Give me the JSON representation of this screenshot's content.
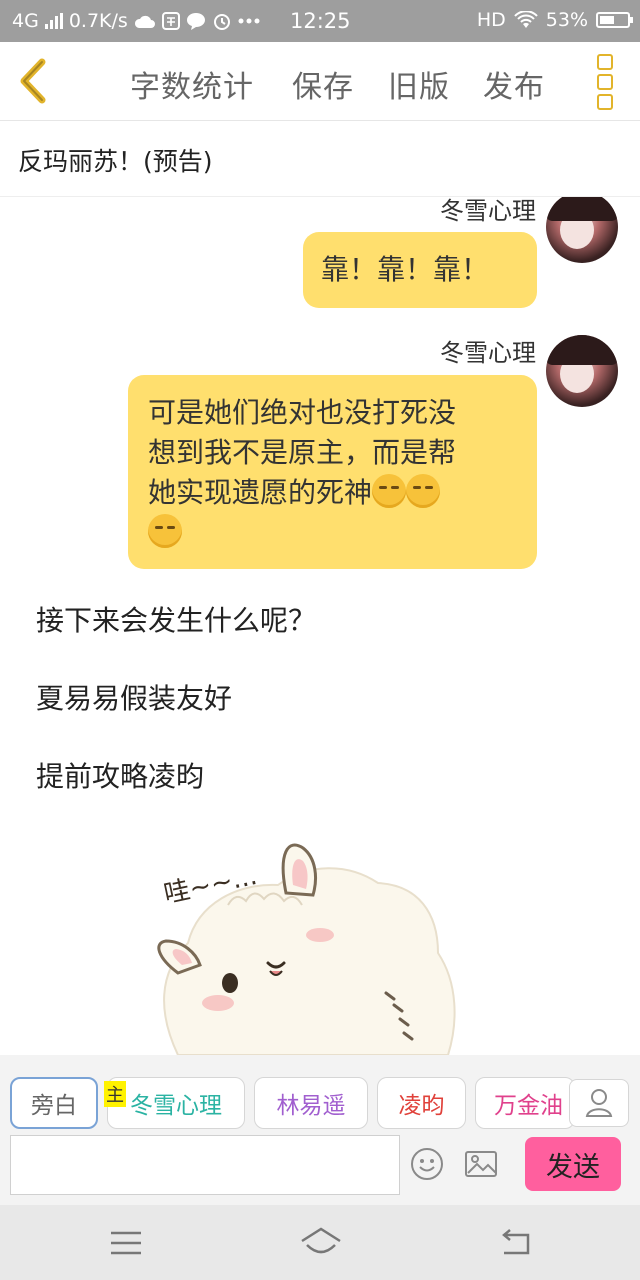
{
  "status_bar": {
    "network": "4G",
    "speed": "0.7K/s",
    "time": "12:25",
    "hd": "HD",
    "battery_text": "53%",
    "battery_level": 0.53
  },
  "toolbar": {
    "word_count": "字数统计",
    "save": "保存",
    "old_version": "旧版",
    "publish": "发布"
  },
  "story": {
    "title": "反玛丽苏！(预告)"
  },
  "chat": {
    "messages": [
      {
        "sender": "冬雪心理",
        "text": "靠！靠！靠！"
      },
      {
        "sender": "冬雪心理",
        "line1": "可是她们绝对也没打死没",
        "line2": "想到我不是原主，而是帮",
        "line3": "她实现遗愿的死神"
      }
    ],
    "narrations": [
      "接下来会发生什么呢？",
      "夏易易假装友好",
      "提前攻略凌昀"
    ],
    "sticker_caption": "哇~~..."
  },
  "roles": {
    "items": [
      {
        "label": "旁白",
        "color": "#666666"
      },
      {
        "label": "冬雪心理",
        "color": "#2bb3a3"
      },
      {
        "label": "林易遥",
        "color": "#a15fcf"
      },
      {
        "label": "凌昀",
        "color": "#e0413a"
      },
      {
        "label": "万金油",
        "color": "#e0418c"
      }
    ],
    "main_badge": "主"
  },
  "composer": {
    "input_value": "",
    "send_label": "发送"
  },
  "colors": {
    "bubble": "#ffdf6e",
    "accent": "#e2b42b",
    "send": "#ff5f9e"
  }
}
